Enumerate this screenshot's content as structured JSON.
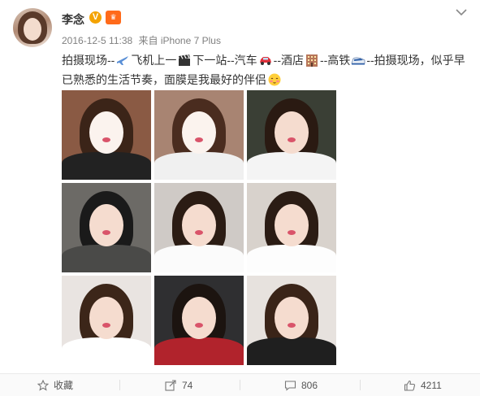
{
  "user": {
    "name": "李念",
    "verified_icon": "verified-v-icon",
    "vip_icon": "vip-crown-icon"
  },
  "meta": {
    "date": "2016-12-5 11:38",
    "source_prefix": "来自",
    "device": "iPhone 7 Plus"
  },
  "post": {
    "segments": [
      "拍摄现场--",
      "飞机上一",
      "下一站--汽车",
      "--酒店",
      "--高铁",
      "--拍摄现场，似乎早",
      "已熟悉的生活节奏，面膜是我最好的伴侣"
    ],
    "emoticons": [
      "airplane-icon",
      "clapperboard-icon",
      "car-icon",
      "hotel-icon",
      "bullet-train-icon",
      "blush-face-icon"
    ]
  },
  "photos": [
    {
      "name": "photo-1",
      "bg": "#8a5a44",
      "hair": "#3b2418",
      "body": "#222222",
      "mask": true
    },
    {
      "name": "photo-2",
      "bg": "#a88472",
      "hair": "#4a2c1f",
      "body": "#f0f0f0",
      "mask": true
    },
    {
      "name": "photo-3",
      "bg": "#3a3f35",
      "hair": "#2a1a12",
      "body": "#f4f4f4",
      "mask": false
    },
    {
      "name": "photo-4",
      "bg": "#6c6a66",
      "hair": "#1a1a1a",
      "body": "#4a4a48",
      "mask": false
    },
    {
      "name": "photo-5",
      "bg": "#cfcac6",
      "hair": "#2b1c14",
      "body": "#fbfbfb",
      "mask": false
    },
    {
      "name": "photo-6",
      "bg": "#d8d2cc",
      "hair": "#2b1c14",
      "body": "#fdfdfd",
      "mask": false
    },
    {
      "name": "photo-7",
      "bg": "#e9e4e1",
      "hair": "#3c2619",
      "body": "#ffffff",
      "mask": false
    },
    {
      "name": "photo-8",
      "bg": "#2f2f31",
      "hair": "#1c1410",
      "body": "#b1232c",
      "mask": false
    },
    {
      "name": "photo-9",
      "bg": "#e7e2de",
      "hair": "#3a2418",
      "body": "#1f1f1f",
      "mask": false
    }
  ],
  "actions": {
    "favorite_label": "收藏",
    "repost_count": "74",
    "comment_count": "806",
    "like_count": "4211"
  },
  "colors": {
    "link_orange": "#eb7350",
    "text": "#333333",
    "meta": "#808080"
  }
}
